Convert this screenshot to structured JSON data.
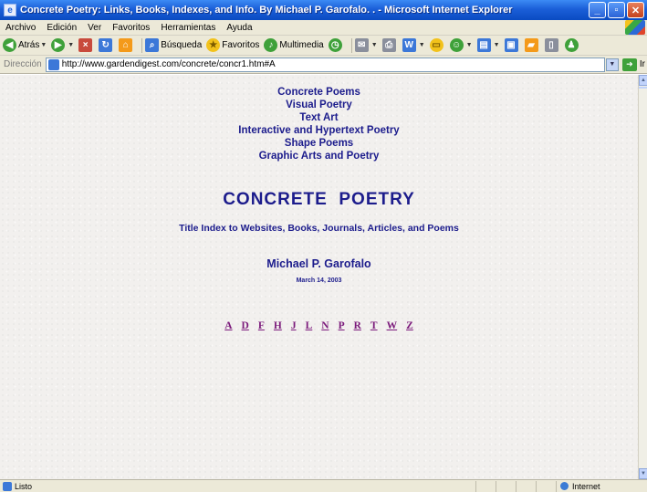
{
  "window": {
    "title": "Concrete Poetry: Links, Books, Indexes, and Info.   By Michael P. Garofalo.     . - Microsoft Internet Explorer",
    "minimize": "_",
    "maximize": "▫",
    "close": "✕"
  },
  "menu": [
    "Archivo",
    "Edición",
    "Ver",
    "Favoritos",
    "Herramientas",
    "Ayuda"
  ],
  "toolbar": {
    "back_label": "Atrás",
    "search_label": "Búsqueda",
    "favorites_label": "Favoritos",
    "multimedia_label": "Multimedia"
  },
  "address": {
    "label": "Dirección",
    "url": "http://www.gardendigest.com/concrete/concr1.htm#A",
    "go_label": "Ir"
  },
  "page": {
    "nav_links": [
      "Concrete Poems",
      "Visual Poetry",
      "Text Art",
      "Interactive and Hypertext Poetry",
      "Shape Poems",
      "Graphic Arts and Poetry"
    ],
    "title": "CONCRETE  POETRY",
    "subtitle": "Title Index to Websites, Books, Journals, Articles, and Poems",
    "author": "Michael P. Garofalo",
    "date": "March 14, 2003",
    "letters": [
      "A",
      "D",
      "F",
      "H",
      "J",
      "L",
      "N",
      "P",
      "R",
      "T",
      "W",
      "Z"
    ],
    "colors": {
      "text": "#1c1c8c",
      "letter_links": "#7b1a7b"
    }
  },
  "status": {
    "text": "Listo",
    "zone": "Internet"
  }
}
